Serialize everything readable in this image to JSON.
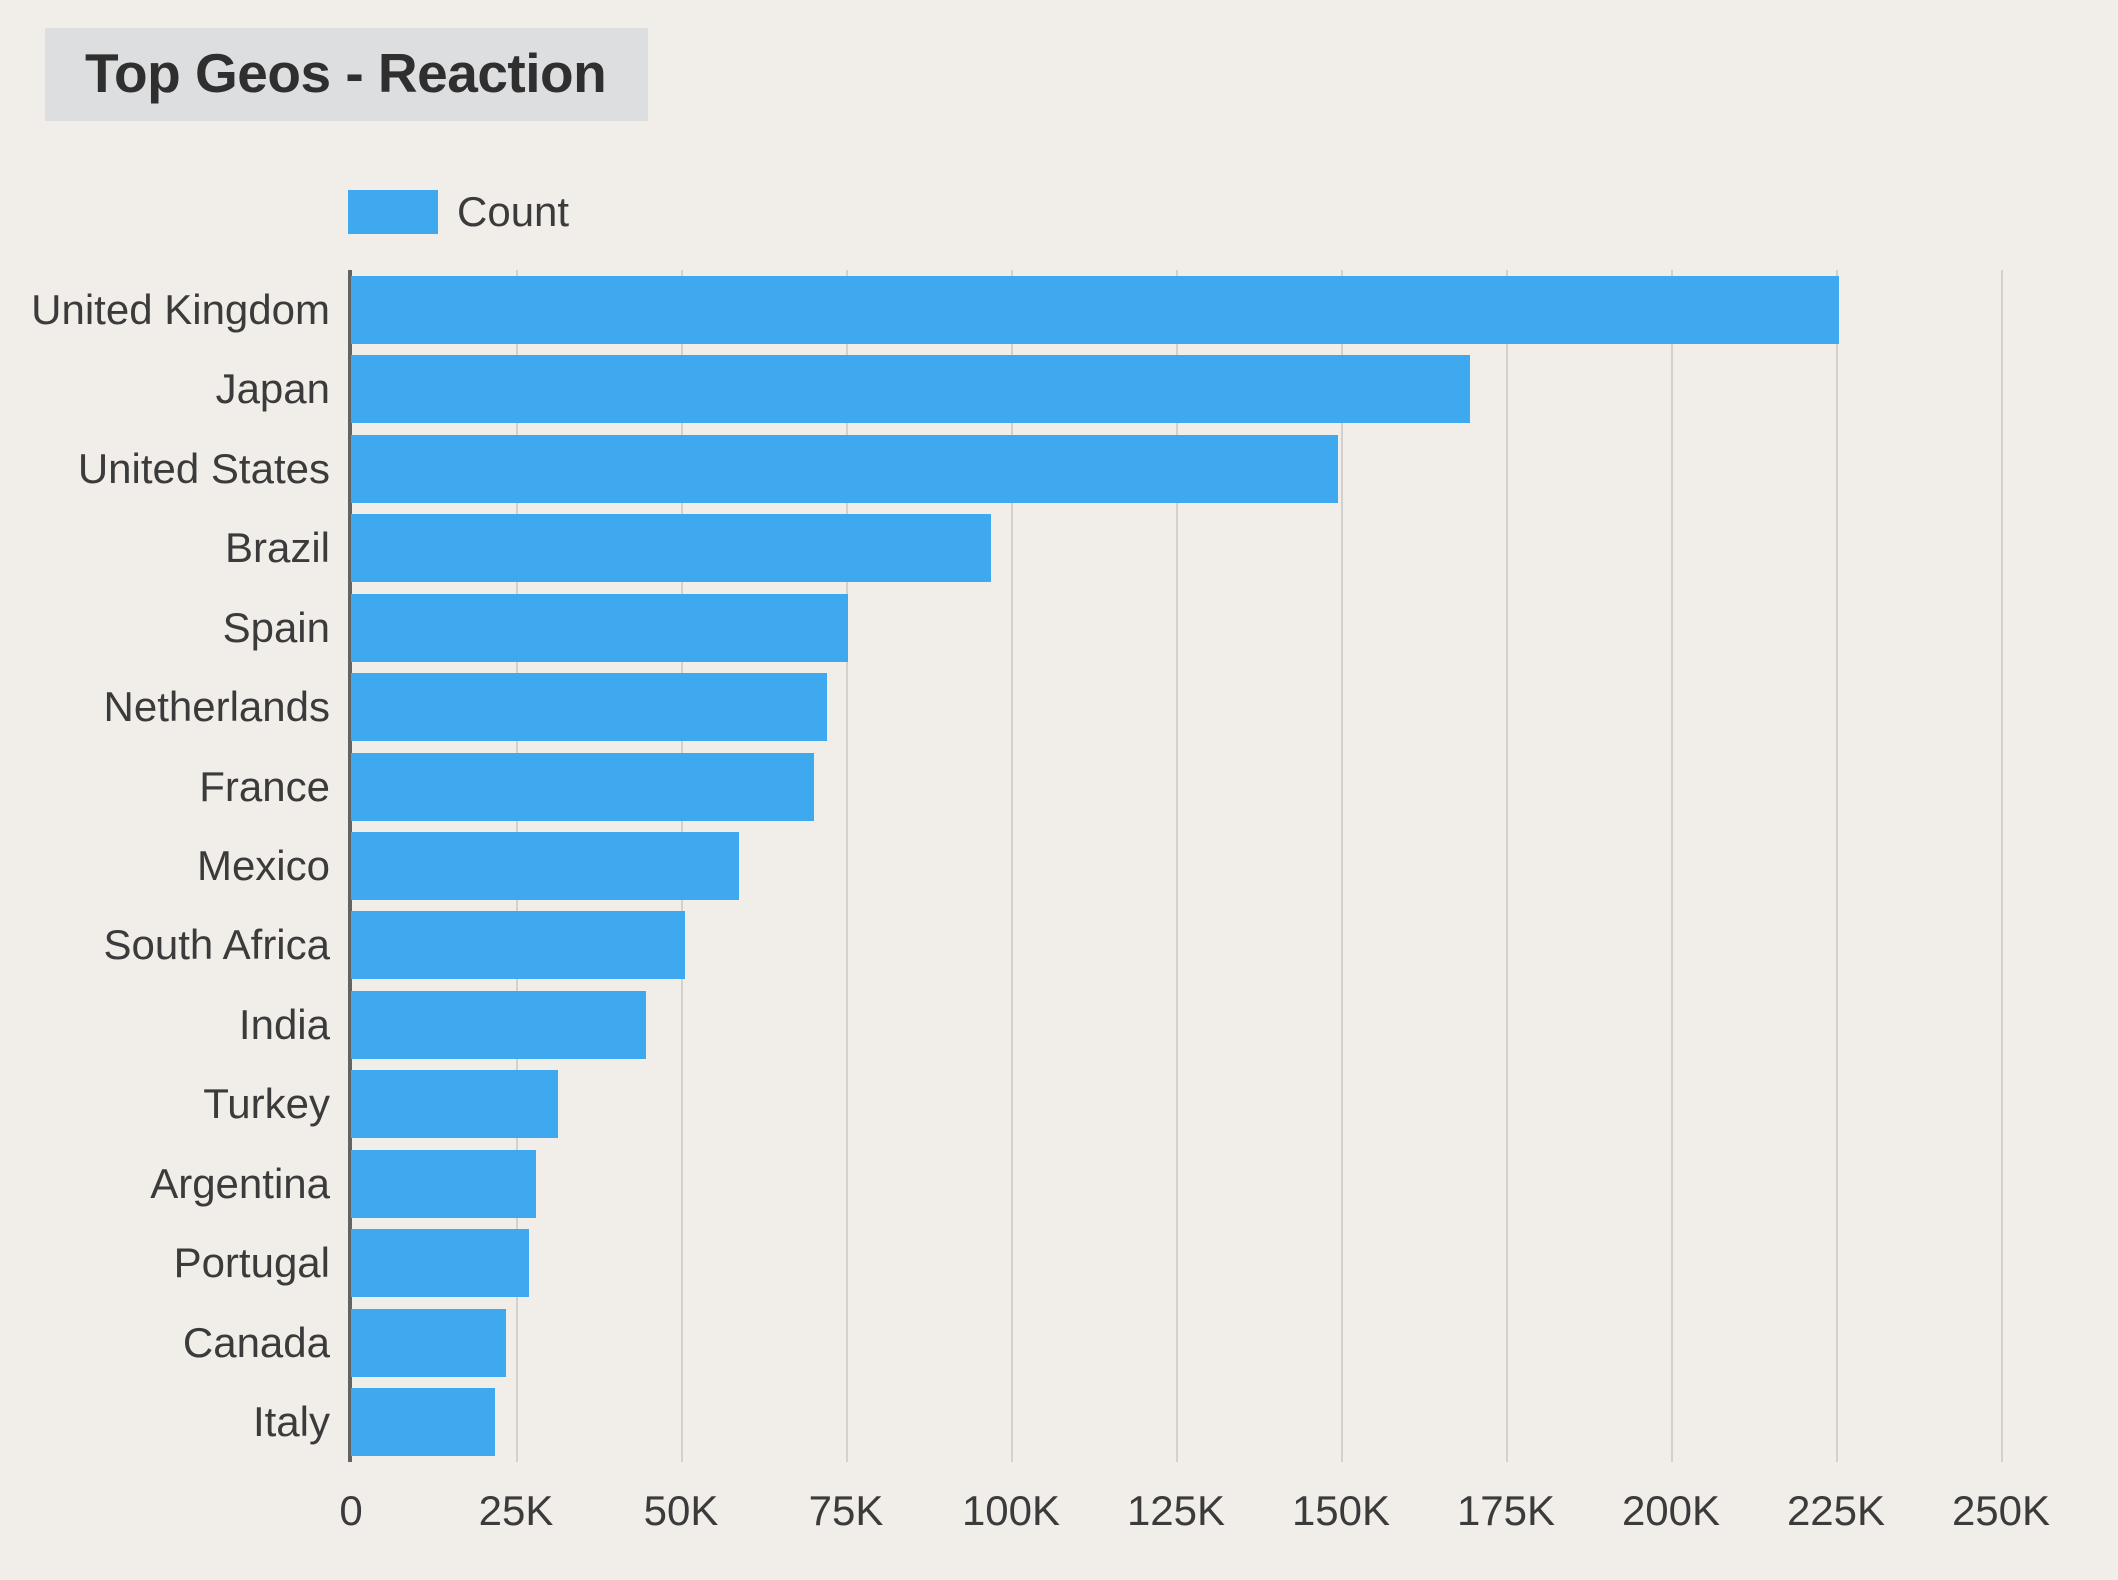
{
  "header": {
    "title": "Top Geos - Reaction"
  },
  "legend": {
    "position": "top-left",
    "items": [
      {
        "label": "Count",
        "color": "#3fa9f0"
      }
    ]
  },
  "colors": {
    "background": "#f1eee9",
    "title_box": "#dddee0",
    "bar": "#3fa9f0",
    "gridline": "#d3d1cd",
    "axis": "#636363",
    "text": "#3b3b3b"
  },
  "chart_data": {
    "type": "bar",
    "orientation": "horizontal",
    "title": "Top Geos - Reaction",
    "xlabel": "",
    "ylabel": "",
    "xlim": [
      0,
      250000
    ],
    "grid": true,
    "legend_position": "top-left",
    "xticks": [
      0,
      25000,
      50000,
      75000,
      100000,
      125000,
      150000,
      175000,
      200000,
      225000,
      250000
    ],
    "xticklabels": [
      "0",
      "25K",
      "50K",
      "75K",
      "100K",
      "125K",
      "150K",
      "175K",
      "200K",
      "225K",
      "250K"
    ],
    "categories": [
      "United Kingdom",
      "Japan",
      "United States",
      "Brazil",
      "Spain",
      "Netherlands",
      "France",
      "Mexico",
      "South Africa",
      "India",
      "Turkey",
      "Argentina",
      "Portugal",
      "Canada",
      "Italy"
    ],
    "series": [
      {
        "name": "Count",
        "color": "#3fa9f0",
        "values": [
          225500,
          169500,
          149500,
          97000,
          75300,
          72100,
          70200,
          58800,
          50600,
          44700,
          31400,
          28000,
          27000,
          23500,
          21800
        ]
      }
    ]
  }
}
